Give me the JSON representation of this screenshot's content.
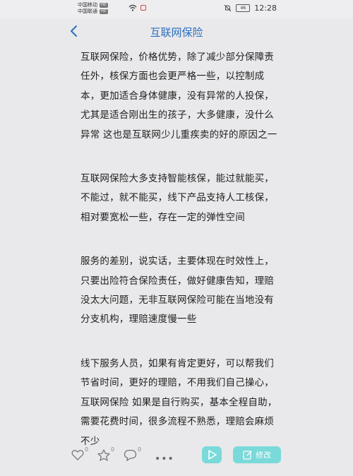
{
  "status_bar": {
    "carrier_1": "中国移动",
    "carrier_2": "中国联通",
    "network_badge": "HD",
    "battery": "46",
    "time": "12:28"
  },
  "nav": {
    "title": "互联网保险"
  },
  "content": {
    "paragraphs": [
      "互联网保险，价格优势，除了减少部分保障责任外，核保方面也会更严格一些，以控制成本，更加适合身体健康，没有异常的人投保，尤其是适合刚出生的孩子，大多健康，没什么异常 这也是互联网少儿重疾卖的好的原因之一",
      "互联网保险大多支持智能核保，能过就能买，不能过，就不能买，线下产品支持人工核保，相对要宽松一些，存在一定的弹性空间",
      "服务的差别，说实话，主要体现在时效性上，只要出险符合保险责任，做好健康告知，理赔没太大问题，无非互联网保险可能在当地没有分支机构，理赔速度慢一些",
      "线下服务人员，如果有肯定更好，可以帮我们节省时间，更好的理赔，不用我们自己操心，互联网保险 如果是自行购买，基本全程自助，需要花费时间，很多流程不熟悉，理赔会麻烦不少"
    ]
  },
  "bottom_bar": {
    "like_count": "0",
    "star_count": "0",
    "comment_count": "0",
    "more": "•••",
    "edit_label": "修改"
  }
}
